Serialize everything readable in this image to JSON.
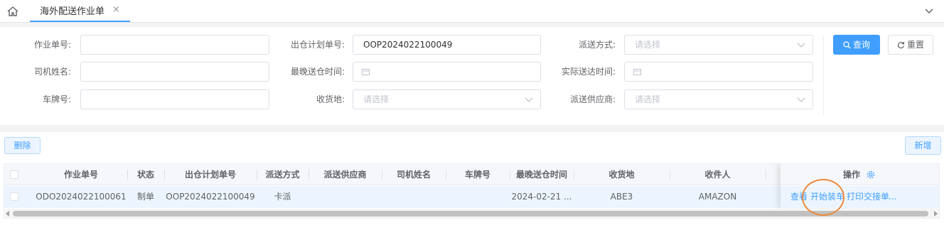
{
  "tabs": {
    "home_icon": "home-icon",
    "active_tab": "海外配送作业单",
    "close_glyph": "×"
  },
  "search": {
    "fields": {
      "order_no": {
        "label": "作业单号:",
        "value": ""
      },
      "plan_no": {
        "label": "出仓计划单号:",
        "value": "OOP2024022100049"
      },
      "delivery_method": {
        "label": "派送方式:",
        "placeholder": "请选择"
      },
      "driver_name": {
        "label": "司机姓名:",
        "value": ""
      },
      "latest_time": {
        "label": "最晚送仓时间:",
        "value": ""
      },
      "actual_time": {
        "label": "实际送达时间:",
        "value": ""
      },
      "plate_no": {
        "label": "车牌号:",
        "value": ""
      },
      "destination": {
        "label": "收货地:",
        "placeholder": "请选择"
      },
      "supplier": {
        "label": "派送供应商:",
        "placeholder": "请选择"
      }
    },
    "query_label": "查询",
    "reset_label": "重置"
  },
  "toolbar": {
    "delete_label": "删除",
    "add_label": "新增"
  },
  "table": {
    "columns": {
      "order_no": "作业单号",
      "status": "状态",
      "plan_no": "出仓计划单号",
      "method": "派送方式",
      "supplier": "派送供应商",
      "driver": "司机姓名",
      "plate": "车牌号",
      "latest": "最晚送仓时间",
      "dest": "收货地",
      "receiver": "收件人",
      "actions": "操作"
    },
    "rows": [
      {
        "order_no": "ODO2024022100061",
        "status": "制单",
        "plan_no": "OOP2024022100049",
        "method": "卡派",
        "supplier": "",
        "driver": "",
        "plate": "",
        "latest": "2024-02-21 ...",
        "dest": "ABE3",
        "receiver": "AMAZON",
        "actions": {
          "view": "查看",
          "start_loading": "开始装车",
          "print": "打印交接单",
          "more": "..."
        }
      }
    ]
  },
  "colors": {
    "primary": "#409eff",
    "highlight_circle": "#ee8a3a"
  }
}
